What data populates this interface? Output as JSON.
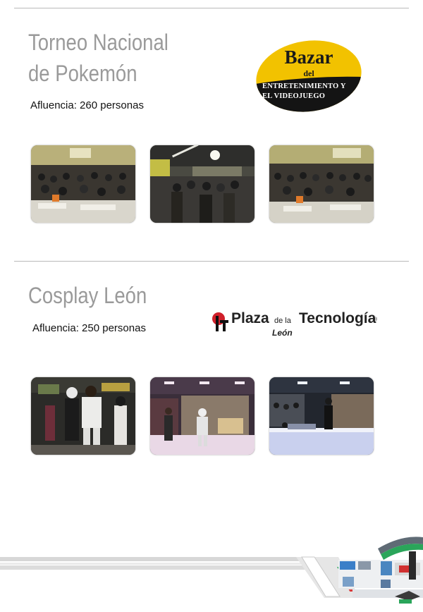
{
  "sections": [
    {
      "title_line1": "Torneo Nacional",
      "title_line2": "de Pokemón",
      "attendance": "Afluencia: 260 personas",
      "logo": {
        "word": "Bazar",
        "del": "del",
        "line1": "ENTRETENIMIENTO Y",
        "line2": "EL VIDEOJUEGO",
        "color_fill": "#f2c200",
        "color_band": "#111111"
      }
    },
    {
      "title_line1": "Cosplay León",
      "attendance": "Afluencia: 250 personas",
      "logo": {
        "word1": "Plaza",
        "word_small": "de la",
        "word2": "Tecnología",
        "reg": "®",
        "city": "León",
        "color_mark": "#d0202a"
      }
    }
  ],
  "colors": {
    "title_gray": "#9a9a9a",
    "rule_gray": "#b9b9b9",
    "accent_green": "#2aa55a"
  }
}
